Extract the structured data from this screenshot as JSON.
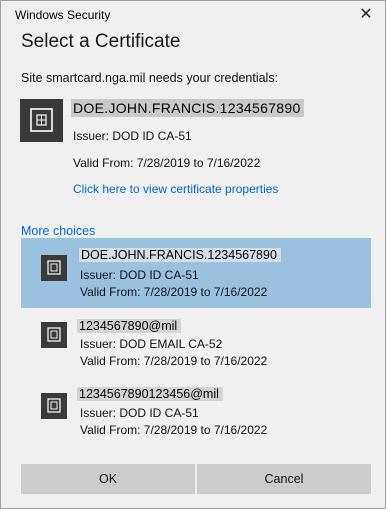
{
  "window": {
    "title": "Windows Security",
    "close_symbol": "✕"
  },
  "dialog": {
    "heading": "Select a Certificate",
    "prompt": "Site smartcard.nga.mil needs your credentials:"
  },
  "selected_certificate": {
    "name": "DOE.JOHN.FRANCIS.1234567890",
    "issuer": "Issuer: DOD ID CA-51",
    "valid": "Valid From: 7/28/2019 to 7/16/2022",
    "properties_link": "Click here to view certificate properties"
  },
  "more_choices_label": "More choices",
  "choices": [
    {
      "name": "DOE.JOHN.FRANCIS.1234567890",
      "issuer": "Issuer: DOD ID CA-51",
      "valid": "Valid From: 7/28/2019 to 7/16/2022",
      "selected": true
    },
    {
      "name": "1234567890@mil",
      "issuer": "Issuer: DOD EMAIL CA-52",
      "valid": "Valid From: 7/28/2019 to 7/16/2022",
      "selected": false
    },
    {
      "name": "1234567890123456@mil",
      "issuer": "Issuer: DOD ID CA-51",
      "valid": "Valid From: 7/28/2019 to 7/16/2022",
      "selected": false
    }
  ],
  "buttons": {
    "ok": "OK",
    "cancel": "Cancel"
  },
  "colors": {
    "accent_link": "#0066cc",
    "selection": "#99c1e0",
    "button": "#cccccc",
    "icon_bg": "#3a3a3a"
  }
}
